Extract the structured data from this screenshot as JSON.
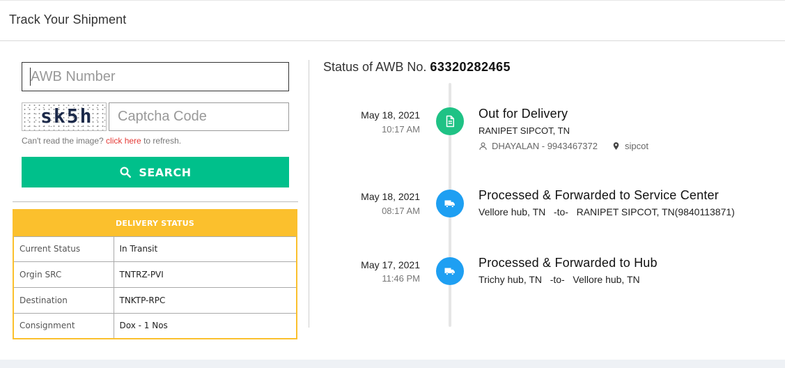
{
  "header": {
    "title": "Track Your Shipment"
  },
  "form": {
    "awb_placeholder": "AWB Number",
    "captcha_text": "sk5h",
    "captcha_placeholder": "Captcha Code",
    "refresh_prefix": "Can't read the image?",
    "refresh_link": "click here",
    "refresh_suffix": "to refresh.",
    "search_label": "SEARCH"
  },
  "delivery_status": {
    "heading": "DELIVERY STATUS",
    "rows": [
      {
        "label": "Current Status",
        "value": "In Transit"
      },
      {
        "label": "Orgin SRC",
        "value": "TNTRZ-PVI"
      },
      {
        "label": "Destination",
        "value": "TNKTP-RPC"
      },
      {
        "label": "Consignment",
        "value": "Dox - 1 Nos"
      }
    ]
  },
  "awb_status": {
    "prefix": "Status of AWB No.",
    "number": "63320282465"
  },
  "timeline": [
    {
      "date": "May 18, 2021",
      "time": "10:17 AM",
      "icon": "document-icon",
      "title": "Out for Delivery",
      "location": "RANIPET SIPCOT, TN",
      "person": "DHAYALAN - 9943467372",
      "place": "sipcot"
    },
    {
      "date": "May 18, 2021",
      "time": "08:17 AM",
      "icon": "truck-icon",
      "title": "Processed & Forwarded to Service Center",
      "from": "Vellore hub, TN",
      "to_word": "-to-",
      "to": "RANIPET SIPCOT, TN(9840113871)"
    },
    {
      "date": "May 17, 2021",
      "time": "11:46 PM",
      "icon": "truck-icon",
      "title": "Processed & Forwarded to Hub",
      "from": "Trichy hub, TN",
      "to_word": "-to-",
      "to": "Vellore hub, TN"
    }
  ],
  "colors": {
    "accent_green": "#00c08b",
    "status_yellow": "#fbc02d",
    "icon_blue": "#1e9ff2",
    "link_red": "#e53935"
  }
}
